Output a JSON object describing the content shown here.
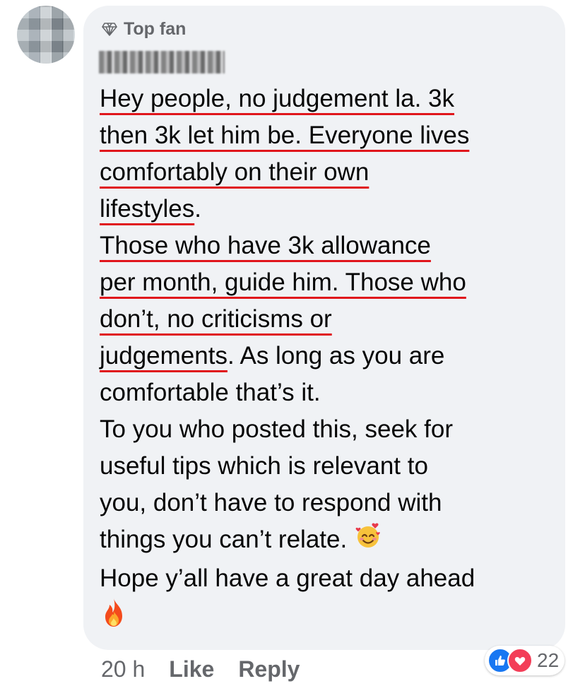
{
  "comment": {
    "badge_label": "Top fan",
    "lines": [
      {
        "type": "u",
        "text": "Hey people, no judgement la. 3k"
      },
      {
        "type": "u",
        "text": "then 3k let him be. Everyone lives"
      },
      {
        "type": "u",
        "text": "comfortably on their own"
      },
      {
        "type": "mixed",
        "u": "lifestyles",
        "rest": "."
      },
      {
        "type": "u",
        "text": "Those who have 3k allowance"
      },
      {
        "type": "u",
        "text": "per month, guide him. Those who"
      },
      {
        "type": "u",
        "text": "don’t, no criticisms or"
      },
      {
        "type": "mixed",
        "u": "judgements",
        "rest": ". As long as you are"
      },
      {
        "type": "p",
        "text": "comfortable that’s it."
      },
      {
        "type": "p",
        "text": "To you who posted this, seek for"
      },
      {
        "type": "p",
        "text": "useful tips which is relevant to"
      },
      {
        "type": "p",
        "text": "you, don’t have to respond with"
      },
      {
        "type": "p",
        "text": "things you can’t relate."
      },
      {
        "type": "p",
        "text": "Hope y’all have a great day ahead"
      }
    ],
    "emoji_smiling_hearts": "smiling-face-with-hearts-icon",
    "emoji_fire": "fire-icon"
  },
  "footer": {
    "time": "20 h",
    "like_label": "Like",
    "reply_label": "Reply"
  },
  "reactions": {
    "count": "22",
    "icons": [
      "like-icon",
      "love-icon"
    ]
  },
  "colors": {
    "bubble": "#f0f2f5",
    "underline": "#e0161c",
    "meta": "#65676b",
    "like": "#1877f2",
    "love": "#f33e58"
  }
}
